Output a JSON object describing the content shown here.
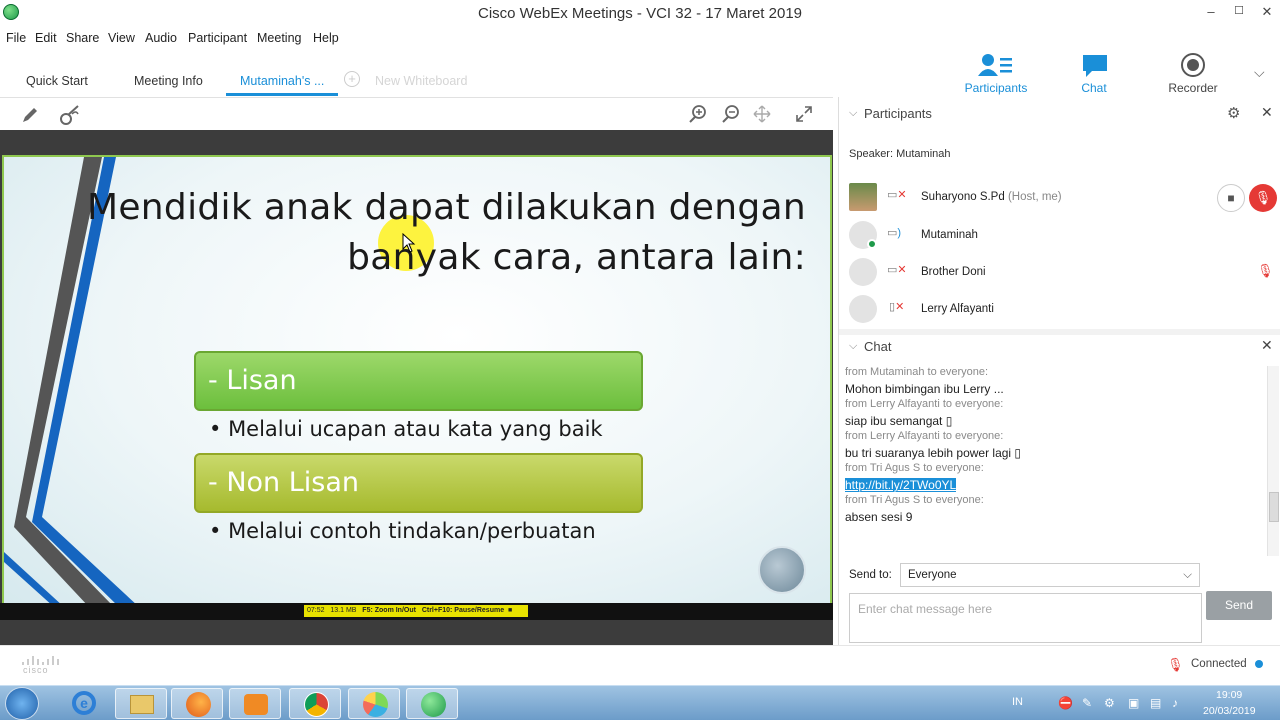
{
  "window": {
    "title": "Cisco WebEx Meetings - VCI 32 - 17 Maret 2019",
    "minimize": "–",
    "maximize": "☐",
    "close": "✕"
  },
  "menu": [
    "File",
    "Edit",
    "Share",
    "View",
    "Audio",
    "Participant",
    "Meeting",
    "Help"
  ],
  "tabs": {
    "quick_start": "Quick Start",
    "meeting_info": "Meeting Info",
    "mutaminah": "Mutaminah's ...",
    "new_whiteboard": "New Whiteboard"
  },
  "right_toolbar": {
    "participants": "Participants",
    "chat": "Chat",
    "recorder": "Recorder"
  },
  "slide": {
    "title_line1": "Mendidik anak dapat dilakukan dengan",
    "title_line2": "banyak cara, antara lain:",
    "box1": "- Lisan",
    "bullet1": "Melalui ucapan atau kata yang baik",
    "box2": "- Non Lisan",
    "bullet2": "Melalui contoh tindakan/perbuatan"
  },
  "pres_status": {
    "time": "07:52",
    "size": "13.1 MB",
    "zoom_hint": "F5: Zoom In/Out",
    "pause_hint": "Ctrl+F10: Pause/Resume"
  },
  "participants": {
    "header": "Participants",
    "speaker_label": "Speaker:",
    "speaker_name": "Mutaminah",
    "list": [
      {
        "name": "Suharyono S.Pd",
        "role": "(Host, me)"
      },
      {
        "name": "Mutaminah",
        "role": ""
      },
      {
        "name": "Brother Doni",
        "role": ""
      },
      {
        "name": "Lerry Alfayanti",
        "role": ""
      }
    ]
  },
  "chat": {
    "header": "Chat",
    "messages": [
      {
        "from": "from Mutaminah to everyone:",
        "text": "Mohon bimbingan ibu Lerry ..."
      },
      {
        "from": "from Lerry Alfayanti to everyone:",
        "text": "siap ibu semangat ▯"
      },
      {
        "from": "from Lerry Alfayanti to everyone:",
        "text": "bu tri suaranya lebih power lagi ▯"
      },
      {
        "from": "from Tri Agus S to everyone:",
        "text": "http://bit.ly/2TWo0YL"
      },
      {
        "from": "from Tri Agus S to everyone:",
        "text": "absen sesi 9"
      }
    ],
    "send_to_label": "Send to:",
    "send_to_value": "Everyone",
    "placeholder": "Enter chat message here",
    "send_button": "Send"
  },
  "footer": {
    "brand": "cisco",
    "status": "Connected"
  },
  "taskbar": {
    "lang": "IN",
    "time": "19:09",
    "date": "20/03/2019"
  },
  "colors": {
    "accent": "#1a8fd8",
    "slide_border": "#8fc84f",
    "box1": "#7cc64a",
    "box2": "#b3c53a",
    "status_green": "#1e9a4a",
    "mute_red": "#e53935"
  }
}
